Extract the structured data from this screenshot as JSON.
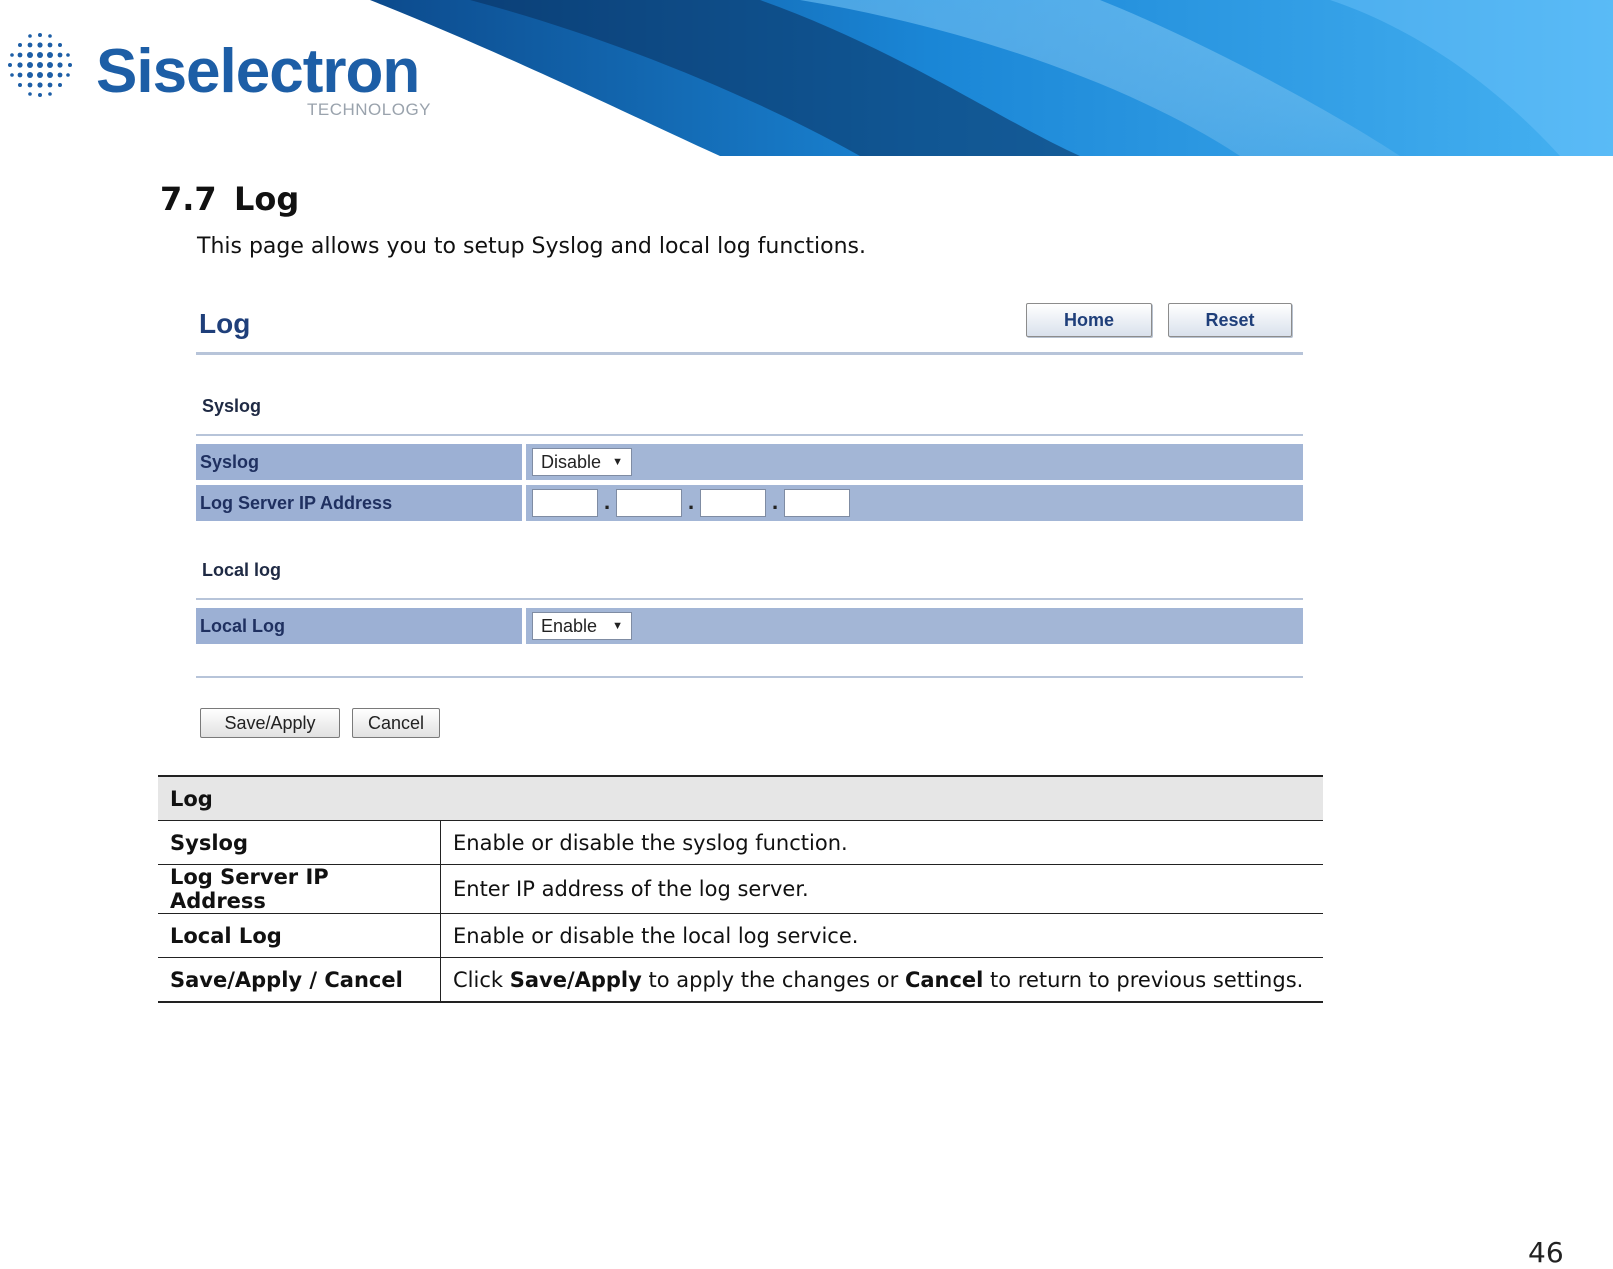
{
  "header": {
    "brand": "Siselectron",
    "brand_sub": "TECHNOLOGY"
  },
  "section": {
    "number": "7.7",
    "title": "Log",
    "intro": "This page allows you to setup Syslog and local log functions."
  },
  "ui": {
    "title": "Log",
    "home_button": "Home",
    "reset_button": "Reset",
    "syslog_heading": "Syslog",
    "syslog_label": "Syslog",
    "syslog_value": "Disable",
    "server_ip_label": "Log Server IP Address",
    "ip_separator": ".",
    "local_heading": "Local log",
    "local_label": "Local Log",
    "local_value": "Enable",
    "save_button": "Save/Apply",
    "cancel_button": "Cancel"
  },
  "table": {
    "header": "Log",
    "rows": [
      {
        "key": "Syslog",
        "desc": "Enable or disable the syslog function."
      },
      {
        "key": "Log Server IP Address",
        "desc": "Enter IP address of the log server."
      },
      {
        "key": "Local Log",
        "desc": "Enable or disable the local log service."
      },
      {
        "key": "Save/Apply / Cancel",
        "desc_pre": "Click ",
        "desc_b1": "Save/Apply",
        "desc_mid": " to apply the changes or ",
        "desc_b2": "Cancel",
        "desc_post": " to return to previous settings."
      }
    ]
  },
  "page_number": "46",
  "colors": {
    "brand_blue": "#1d5ea6",
    "row_blue": "#a3b6d6",
    "header_gray": "#e6e6e6"
  }
}
